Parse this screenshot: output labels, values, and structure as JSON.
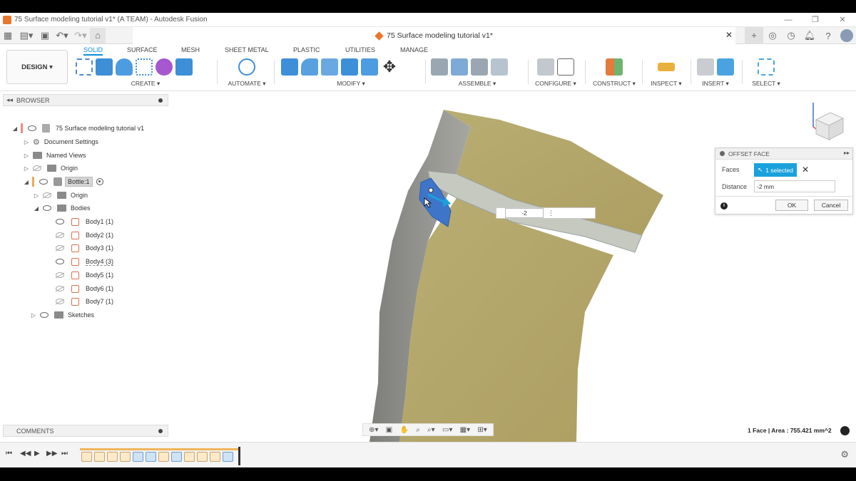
{
  "window": {
    "title": "75 Surface modeling tutorial v1* (A TEAM) - Autodesk Fusion",
    "controls": [
      "—",
      "❐",
      "✕"
    ]
  },
  "document_tab": {
    "label": "75 Surface modeling tutorial v1*"
  },
  "ribbon": {
    "workspace": "DESIGN ▾",
    "tabs": [
      "SOLID",
      "SURFACE",
      "MESH",
      "SHEET METAL",
      "PLASTIC",
      "UTILITIES",
      "MANAGE"
    ],
    "active_tab": "SOLID",
    "groups": [
      "CREATE ▾",
      "AUTOMATE ▾",
      "MODIFY ▾",
      "ASSEMBLE ▾",
      "CONFIGURE ▾",
      "CONSTRUCT ▾",
      "INSPECT ▾",
      "INSERT ▾",
      "SELECT ▾"
    ]
  },
  "browser": {
    "title": "BROWSER",
    "root": "75 Surface modeling tutorial v1",
    "items": {
      "document_settings": "Document Settings",
      "named_views": "Named Views",
      "origin_root": "Origin",
      "bottle": "Bottle:1",
      "origin_bottle": "Origin",
      "bodies": "Bodies",
      "body1": "Body1 (1)",
      "body2": "Body2 (1)",
      "body3": "Body3 (1)",
      "body4": "Body4 (3)",
      "body5": "Body5 (1)",
      "body6": "Body6 (1)",
      "body7": "Body7 (1)",
      "sketches": "Sketches"
    }
  },
  "comments": {
    "title": "COMMENTS"
  },
  "offset_face_dialog": {
    "title": "OFFSET FACE",
    "faces_label": "Faces",
    "faces_value": "1 selected",
    "distance_label": "Distance",
    "distance_value": "-2 mm",
    "ok": "OK",
    "cancel": "Cancel"
  },
  "canvas_input": {
    "value": "-2"
  },
  "status": {
    "selection_info": "1 Face | Area : 755.421 mm^2"
  },
  "colors": {
    "surface": "#b7ac6f",
    "side_wall": "#9a9a96",
    "selected_face": "#3e75c9",
    "accent": "#1ba1dc"
  }
}
